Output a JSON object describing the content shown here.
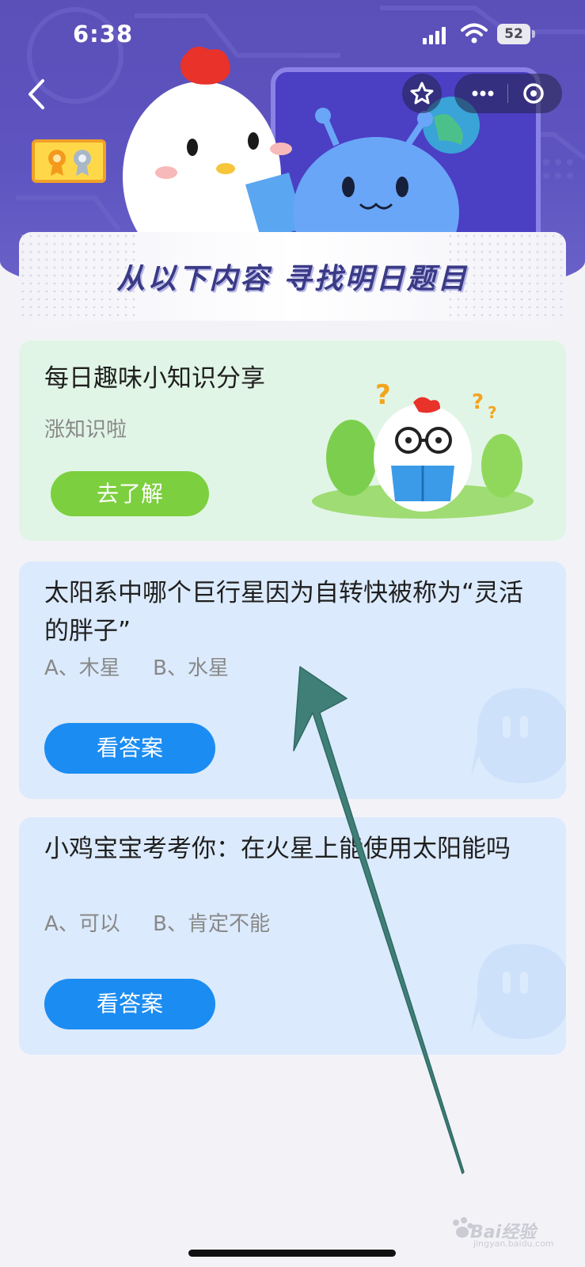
{
  "status_bar": {
    "time": "6:38",
    "battery": "52"
  },
  "header": {
    "banner_title": "从以下内容 寻找明日题目"
  },
  "cards": [
    {
      "title": "每日趣味小知识分享",
      "subtitle": "涨知识啦",
      "button_label": "去了解"
    },
    {
      "question": "太阳系中哪个巨行星因为自转快被称为“灵活的胖子”",
      "options": "A、木星     B、水星",
      "button_label": "看答案"
    },
    {
      "question": "小鸡宝宝考考你：在火星上能使用太阳能吗",
      "options": "A、可以     B、肯定不能",
      "button_label": "看答案"
    }
  ],
  "watermark": {
    "text": "Bai经验",
    "sub": "jingyan.baidu.com"
  },
  "icons": [
    "back-icon",
    "star-icon",
    "more-icon",
    "target-icon",
    "signal-icon",
    "wifi-icon",
    "battery-icon",
    "medal-icon",
    "chat-bubble-icon",
    "arrow-annotation"
  ],
  "colors": {
    "banner": "#5e54c0",
    "green_card": "#e1f5e6",
    "blue_card": "#dbeafc",
    "green_button": "#7ccf3e",
    "blue_button": "#1b8cf2",
    "arrow": "#3f7f78"
  }
}
